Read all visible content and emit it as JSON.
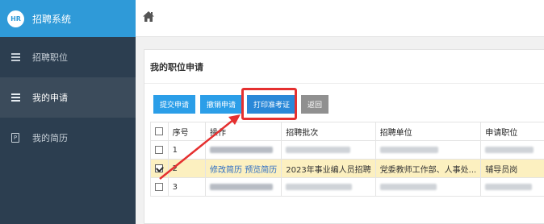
{
  "brand": {
    "logo": "HR",
    "name": "招聘系统"
  },
  "sidebar": {
    "items": [
      {
        "label": "招聘职位",
        "icon": "menu-icon",
        "active": false
      },
      {
        "label": "我的申请",
        "icon": "menu-icon",
        "active": true
      },
      {
        "label": "我的简历",
        "icon": "document-icon",
        "active": false
      }
    ]
  },
  "header": {
    "icon": "home-icon"
  },
  "panel": {
    "title": "我的职位申请",
    "buttons": {
      "submit": "提交申请",
      "withdraw": "撤销申请",
      "print_ticket": "打印准考证",
      "back": "返回"
    }
  },
  "table": {
    "columns": [
      "序号",
      "操作",
      "招聘批次",
      "招聘单位",
      "申请职位"
    ],
    "rows": [
      {
        "index": "1",
        "checked": false
      },
      {
        "index": "2",
        "checked": true,
        "action_edit": "修改简历",
        "action_preview": "预览简历",
        "batch": "2023年事业编人员招聘",
        "unit": "党委教师工作部、人事处...",
        "position": "辅导员岗"
      },
      {
        "index": "3",
        "checked": false
      }
    ]
  },
  "colors": {
    "sidebar_bg": "#2c3e50",
    "brand_bg": "#2f9ad8",
    "highlight": "#e53030",
    "selected_row": "#fcf0c0"
  }
}
